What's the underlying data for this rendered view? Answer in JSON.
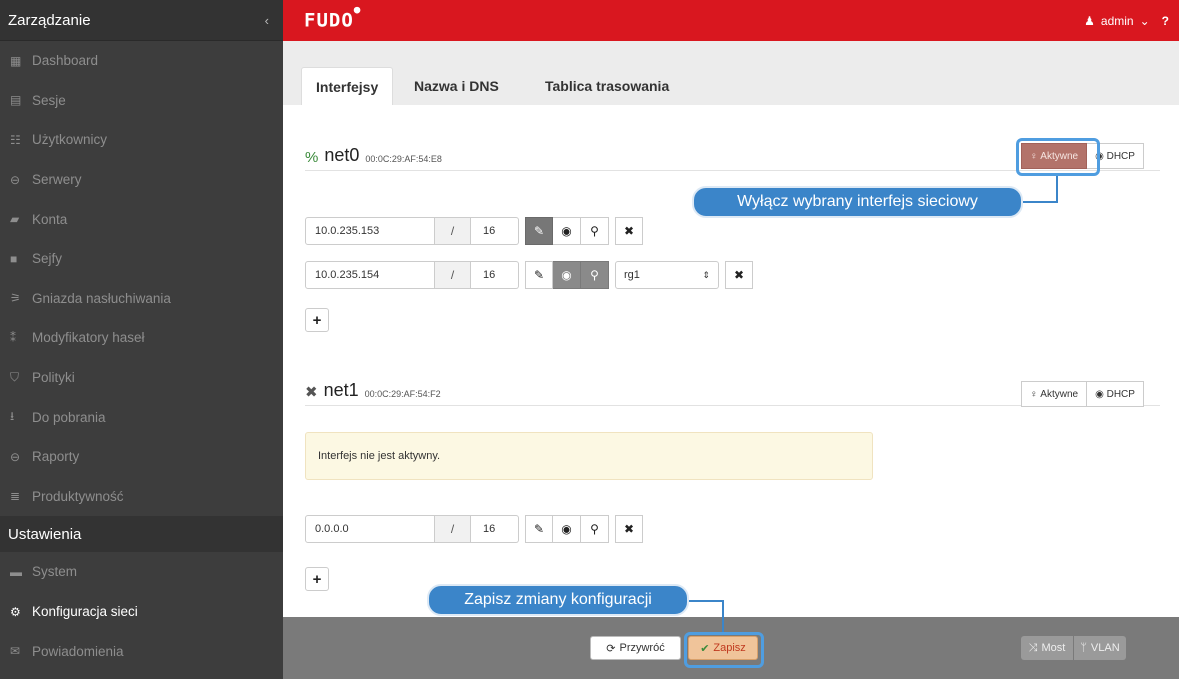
{
  "sidebar": {
    "header": "Zarządzanie",
    "collapse": "‹",
    "items": [
      {
        "icon": "▦",
        "label": "Dashboard"
      },
      {
        "icon": "▤",
        "label": "Sesje"
      },
      {
        "icon": "☷",
        "label": "Użytkownicy"
      },
      {
        "icon": "⊖",
        "label": "Serwery"
      },
      {
        "icon": "▰",
        "label": "Konta"
      },
      {
        "icon": "■",
        "label": "Sejfy"
      },
      {
        "icon": "⚞",
        "label": "Gniazda nasłuchiwania"
      },
      {
        "icon": "⁑",
        "label": "Modyfikatory haseł"
      },
      {
        "icon": "⛉",
        "label": "Polityki"
      },
      {
        "icon": "⭳",
        "label": "Do pobrania"
      },
      {
        "icon": "⊖",
        "label": "Raporty"
      },
      {
        "icon": "≣",
        "label": "Produktywność"
      }
    ],
    "section": "Ustawienia",
    "settings_items": [
      {
        "icon": "▬",
        "label": "System"
      },
      {
        "icon": "⚙",
        "label": "Konfiguracja sieci"
      },
      {
        "icon": "✉",
        "label": "Powiadomienia"
      }
    ]
  },
  "topbar": {
    "logo": "FUDO",
    "user": "admin",
    "help": "?"
  },
  "tabs": [
    "Interfejsy",
    "Nazwa i DNS",
    "Tablica trasowania"
  ],
  "net0": {
    "name": "net0",
    "mac": "00:0C:29:AF:54:E8",
    "active_label": "Aktywne",
    "dhcp_label": "DHCP",
    "rows": [
      {
        "ip": "10.0.235.153",
        "slash": "/",
        "mask": "16"
      },
      {
        "ip": "10.0.235.154",
        "slash": "/",
        "mask": "16",
        "select": "rg1"
      }
    ],
    "add": "+"
  },
  "net1": {
    "name": "net1",
    "mac": "00:0C:29:AF:54:F2",
    "active_label": "Aktywne",
    "dhcp_label": "DHCP",
    "alert": "Interfejs nie jest aktywny.",
    "rows": [
      {
        "ip": "0.0.0.0",
        "slash": "/",
        "mask": "16"
      }
    ],
    "add": "+"
  },
  "footer": {
    "revert": "Przywróć",
    "save": "Zapisz",
    "bridge": "Most",
    "vlan": "VLAN"
  },
  "callouts": {
    "deactivate": "Wyłącz wybrany interfejs sieciowy",
    "save": "Zapisz zmiany konfiguracji"
  }
}
